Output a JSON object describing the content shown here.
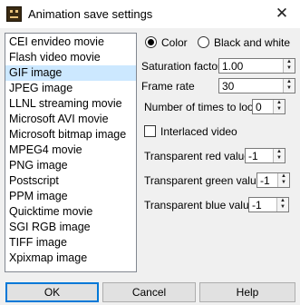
{
  "window": {
    "title": "Animation save settings"
  },
  "formats": {
    "items": [
      "CEI envideo movie",
      "Flash video movie",
      "GIF image",
      "JPEG image",
      "LLNL streaming movie",
      "Microsoft AVI movie",
      "Microsoft bitmap image",
      "MPEG4 movie",
      "PNG image",
      "Postscript",
      "PPM image",
      "Quicktime movie",
      "SGI RGB image",
      "TIFF image",
      "Xpixmap image"
    ],
    "selected": "GIF image"
  },
  "color_mode": {
    "options": [
      "Color",
      "Black and white"
    ],
    "selected": "Color"
  },
  "settings": {
    "saturation_label": "Saturation factor",
    "saturation_value": "1.00",
    "frame_rate_label": "Frame rate",
    "frame_rate_value": "30",
    "loop_label": "Number of times to loop",
    "loop_value": "0",
    "interlaced_label": "Interlaced video",
    "interlaced_checked": false,
    "trans_red_label": "Transparent red value",
    "trans_red_value": "-1",
    "trans_green_label": "Transparent green value",
    "trans_green_value": "-1",
    "trans_blue_label": "Transparent blue value",
    "trans_blue_value": "-1"
  },
  "buttons": {
    "ok": "OK",
    "cancel": "Cancel",
    "help": "Help"
  },
  "icons": {
    "close": "close-icon",
    "app": "app-icon",
    "spin_up": "spin-up-icon",
    "spin_down": "spin-down-icon"
  },
  "colors": {
    "selection": "#cce8ff",
    "default_button_border": "#0078d7"
  }
}
